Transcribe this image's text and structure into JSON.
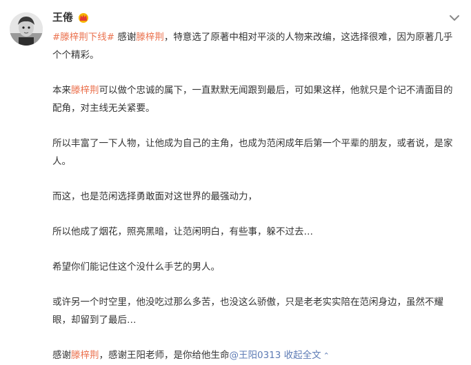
{
  "user": {
    "name": "王倦"
  },
  "post": {
    "p1": {
      "hashtag": "#滕梓荆下线#",
      "t1": "感谢",
      "name": "滕梓荆",
      "t2": "，特意选了原著中相对平淡的人物来改编，这选择很难，因为原著几乎个个精彩。"
    },
    "p2": {
      "t1": "本来",
      "name": "滕梓荆",
      "t2": "可以做个忠诚的属下，一直默默无闻跟到最后，可如果这样，他就只是个记不清面目的配角，对主线无关紧要。"
    },
    "p3": "所以丰富了一下人物，让他成为自己的主角，也成为范闲成年后第一个平辈的朋友，或者说，是家人。",
    "p4": "而这，也是范闲选择勇敢面对这世界的最强动力，",
    "p5": "所以他成了烟花，照亮黑暗，让范闲明白，有些事，躲不过去…",
    "p6": "希望你们能记住这个没什么手艺的男人。",
    "p7": "或许另一个时空里，他没吃过那么多苦，也没这么骄傲，只是老老实实陪在范闲身边，虽然不耀眼，却留到了最后…",
    "p8": {
      "t1": "感谢",
      "name": "滕梓荆",
      "t2": "，感谢王阳老师，是你给他生命",
      "mention": "@王阳0313",
      "expand": "收起全文"
    }
  },
  "icons": {
    "badge": "crown-badge-icon",
    "collapse": "chevron-down-icon",
    "expand": "chevron-up-icon"
  },
  "colors": {
    "link": "#eb7350",
    "mention": "#5d7bb5",
    "text": "#333333"
  }
}
